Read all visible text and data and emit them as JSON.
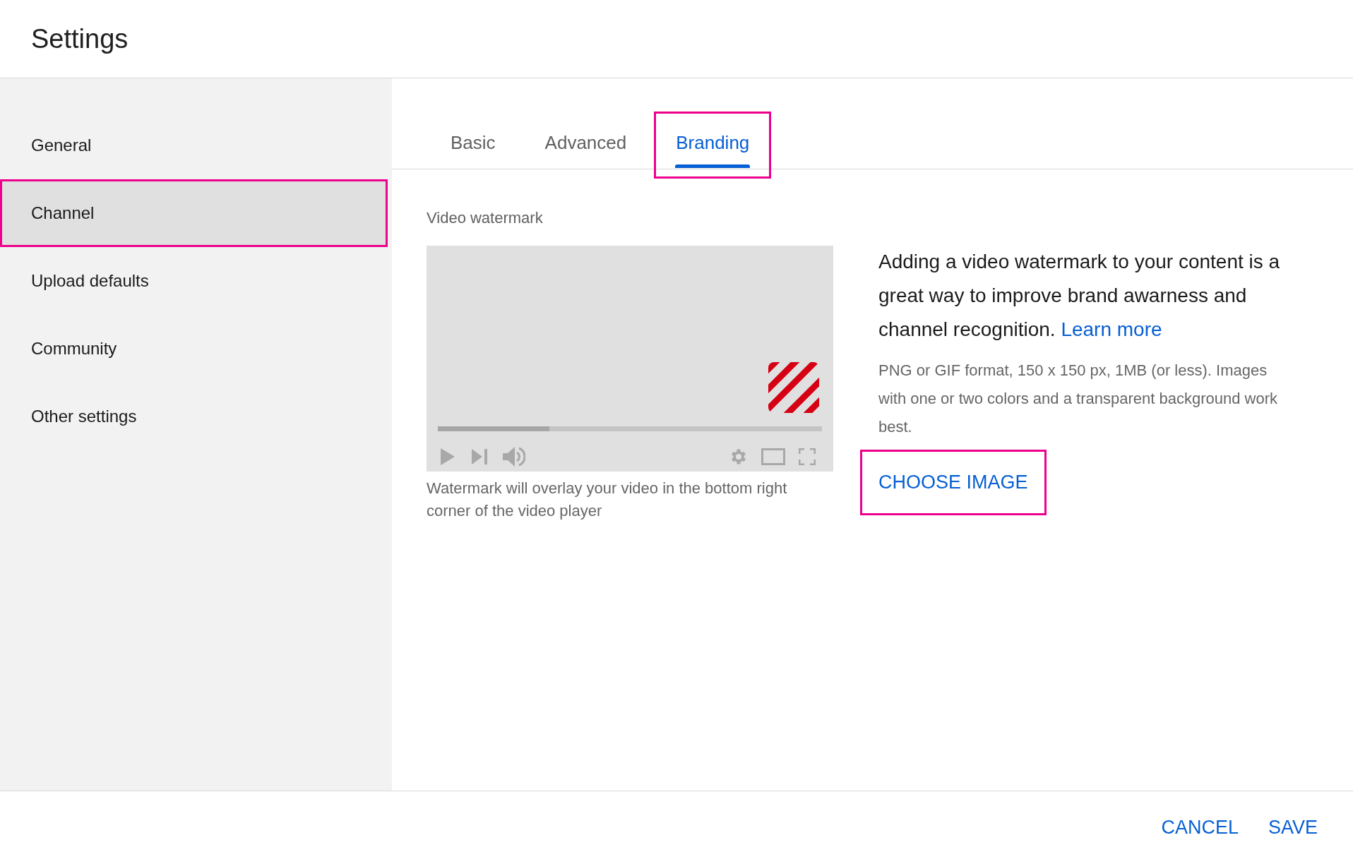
{
  "header": {
    "title": "Settings"
  },
  "sidebar": {
    "items": [
      {
        "label": "General",
        "selected": false,
        "highlighted": false
      },
      {
        "label": "Channel",
        "selected": true,
        "highlighted": true
      },
      {
        "label": "Upload defaults",
        "selected": false,
        "highlighted": false
      },
      {
        "label": "Community",
        "selected": false,
        "highlighted": false
      },
      {
        "label": "Other settings",
        "selected": false,
        "highlighted": false
      }
    ]
  },
  "tabs": [
    {
      "label": "Basic",
      "selected": false,
      "highlighted": false
    },
    {
      "label": "Advanced",
      "selected": false,
      "highlighted": false
    },
    {
      "label": "Branding",
      "selected": true,
      "highlighted": true
    }
  ],
  "section": {
    "title": "Video watermark",
    "player": {
      "progress": {
        "level": 0.29
      }
    },
    "caption": "Watermark will overlay your video in the bottom right corner of the video player",
    "description": "Adding a video watermark to your content is a great way to improve brand awarness and channel recognition.",
    "learn_more": "Learn more",
    "requirements": "PNG or GIF format, 150 x 150 px, 1MB (or less). Images with one or two colors and a transparent background work best.",
    "choose_button": {
      "label": "CHOOSE IMAGE",
      "highlighted": true
    }
  },
  "footer": {
    "buttons": [
      {
        "label": "CANCEL"
      },
      {
        "label": "SAVE"
      }
    ]
  }
}
